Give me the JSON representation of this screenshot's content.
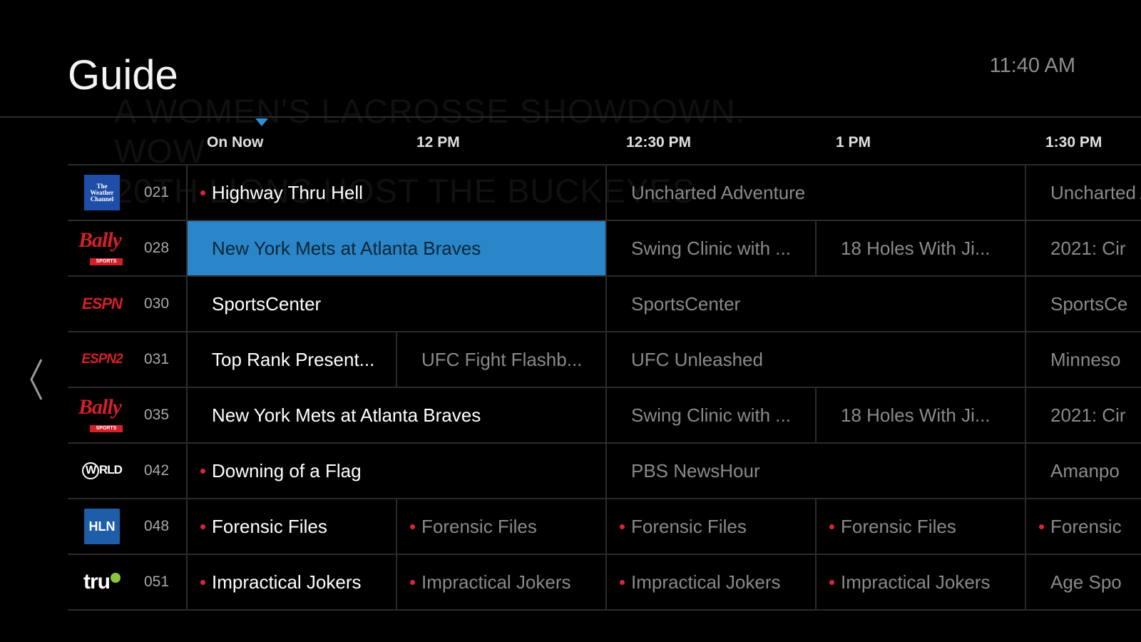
{
  "header": {
    "title": "Guide",
    "clock": "11:40 AM",
    "background_promo": "A WOMEN'S LACROSSE SHOWDOWN. WOW\n20TH LIONS HOST THE BUCKEYES"
  },
  "timeline": {
    "labels": [
      "On Now",
      "12 PM",
      "12:30 PM",
      "1 PM",
      "1:30 PM"
    ]
  },
  "colors": {
    "selected": "#2a86c8",
    "live_dot": "#d8263c",
    "now_marker": "#2f8fd6"
  },
  "channels": [
    {
      "number": "021",
      "logo_icon": "weather-channel-logo-icon",
      "logo_text": [
        "The",
        "Weather",
        "Channel"
      ],
      "programs": [
        {
          "title": "Highway Thru Hell",
          "live": true
        },
        {
          "title": "Uncharted Adventure",
          "live": false
        },
        {
          "title": "Uncharted Adventure",
          "live": false
        }
      ]
    },
    {
      "number": "028",
      "logo_icon": "bally-sports-logo-icon",
      "logo_text": [
        "Bally",
        "SPORTS"
      ],
      "programs": [
        {
          "title": "New York Mets at Atlanta Braves",
          "live": false,
          "selected": true
        },
        {
          "title": "Swing Clinic with ...",
          "live": false
        },
        {
          "title": "18 Holes With Ji...",
          "live": false
        },
        {
          "title": "2021: Cir",
          "live": false
        }
      ]
    },
    {
      "number": "030",
      "logo_icon": "espn-logo-icon",
      "logo_text": [
        "ESPN"
      ],
      "programs": [
        {
          "title": "SportsCenter",
          "live": false
        },
        {
          "title": "SportsCenter",
          "live": false
        },
        {
          "title": "SportsCe",
          "live": false
        }
      ]
    },
    {
      "number": "031",
      "logo_icon": "espn2-logo-icon",
      "logo_text": [
        "ESPN2"
      ],
      "programs": [
        {
          "title": "Top Rank Present...",
          "live": false
        },
        {
          "title": "UFC Fight Flashb...",
          "live": false
        },
        {
          "title": "UFC Unleashed",
          "live": false
        },
        {
          "title": "Minneso",
          "live": false
        }
      ]
    },
    {
      "number": "035",
      "logo_icon": "bally-sports-logo-icon",
      "logo_text": [
        "Bally",
        "SPORTS"
      ],
      "programs": [
        {
          "title": "New York Mets at Atlanta Braves",
          "live": false
        },
        {
          "title": "Swing Clinic with ...",
          "live": false
        },
        {
          "title": "18 Holes With Ji...",
          "live": false
        },
        {
          "title": "2021: Cir",
          "live": false
        }
      ]
    },
    {
      "number": "042",
      "logo_icon": "world-channel-logo-icon",
      "logo_text": [
        "W",
        "RLD"
      ],
      "programs": [
        {
          "title": "Downing of a Flag",
          "live": true
        },
        {
          "title": "PBS NewsHour",
          "live": false
        },
        {
          "title": "Amanpo",
          "live": false
        }
      ]
    },
    {
      "number": "048",
      "logo_icon": "hln-logo-icon",
      "logo_text": [
        "HLN"
      ],
      "programs": [
        {
          "title": "Forensic Files",
          "live": true
        },
        {
          "title": "Forensic Files",
          "live": true
        },
        {
          "title": "Forensic Files",
          "live": true
        },
        {
          "title": "Forensic Files",
          "live": true
        },
        {
          "title": "Forensic",
          "live": true
        }
      ]
    },
    {
      "number": "051",
      "logo_icon": "trutv-logo-icon",
      "logo_text": [
        "tru"
      ],
      "programs": [
        {
          "title": "Impractical Jokers",
          "live": true
        },
        {
          "title": "Impractical Jokers",
          "live": true
        },
        {
          "title": "Impractical Jokers",
          "live": true
        },
        {
          "title": "Impractical Jokers",
          "live": true
        },
        {
          "title": "Age Spo",
          "live": false
        }
      ]
    }
  ]
}
